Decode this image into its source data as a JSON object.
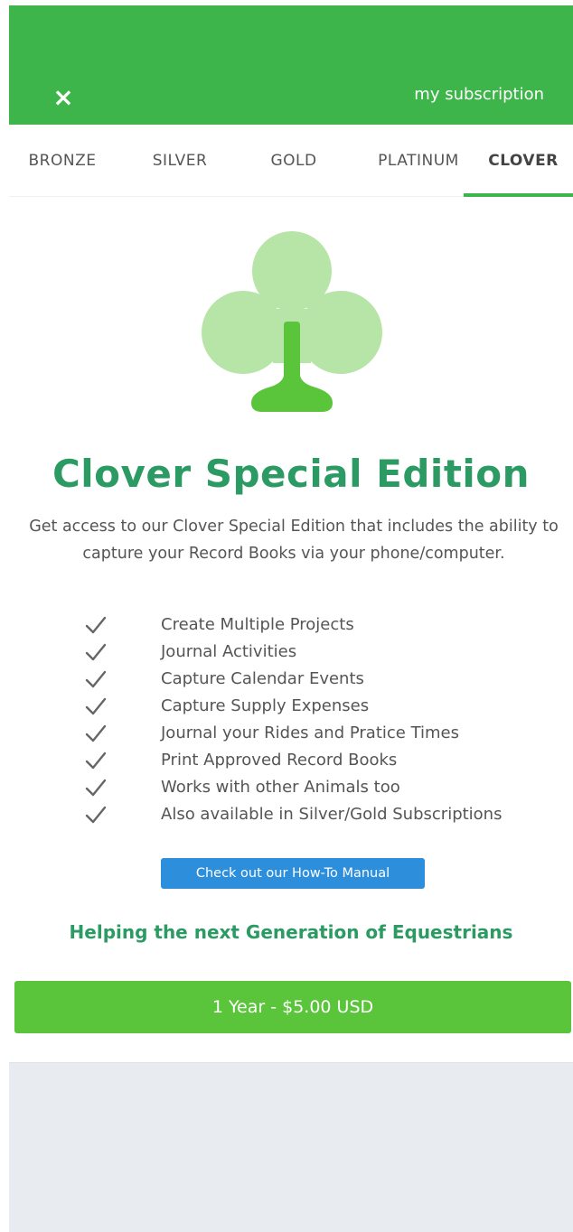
{
  "header": {
    "close_label": "×",
    "title": "my subscription",
    "background": "#3db54a"
  },
  "tabs": [
    {
      "label": "BRONZE",
      "active": false
    },
    {
      "label": "SILVER",
      "active": false
    },
    {
      "label": "GOLD",
      "active": false
    },
    {
      "label": "PLATINUM",
      "active": false
    },
    {
      "label": "CLOVER",
      "active": true
    }
  ],
  "plan": {
    "icon": "clover-icon",
    "title": "Clover Special Edition",
    "description": "Get access to our Clover Special Edition that includes the ability to capture your Record Books via your phone/computer.",
    "features": [
      "Create Multiple Projects",
      "Journal Activities",
      "Capture Calendar Events",
      "Capture Supply Expenses",
      "Journal your Rides and Pratice Times",
      "Print Approved Record Books",
      "Works with other Animals too",
      "Also available in Silver/Gold Subscriptions"
    ],
    "manual_button": "Check out our How-To Manual",
    "tagline": "Helping the next Generation of Equestrians",
    "price_button": "1 Year - $5.00 USD"
  },
  "colors": {
    "accent": "#3db54a",
    "title_green": "#2b9a63",
    "manual_blue": "#2d8fdc",
    "price_green": "#5ac53a",
    "clover_light": "#b7e4a7",
    "clover_dark": "#5ac53a"
  }
}
